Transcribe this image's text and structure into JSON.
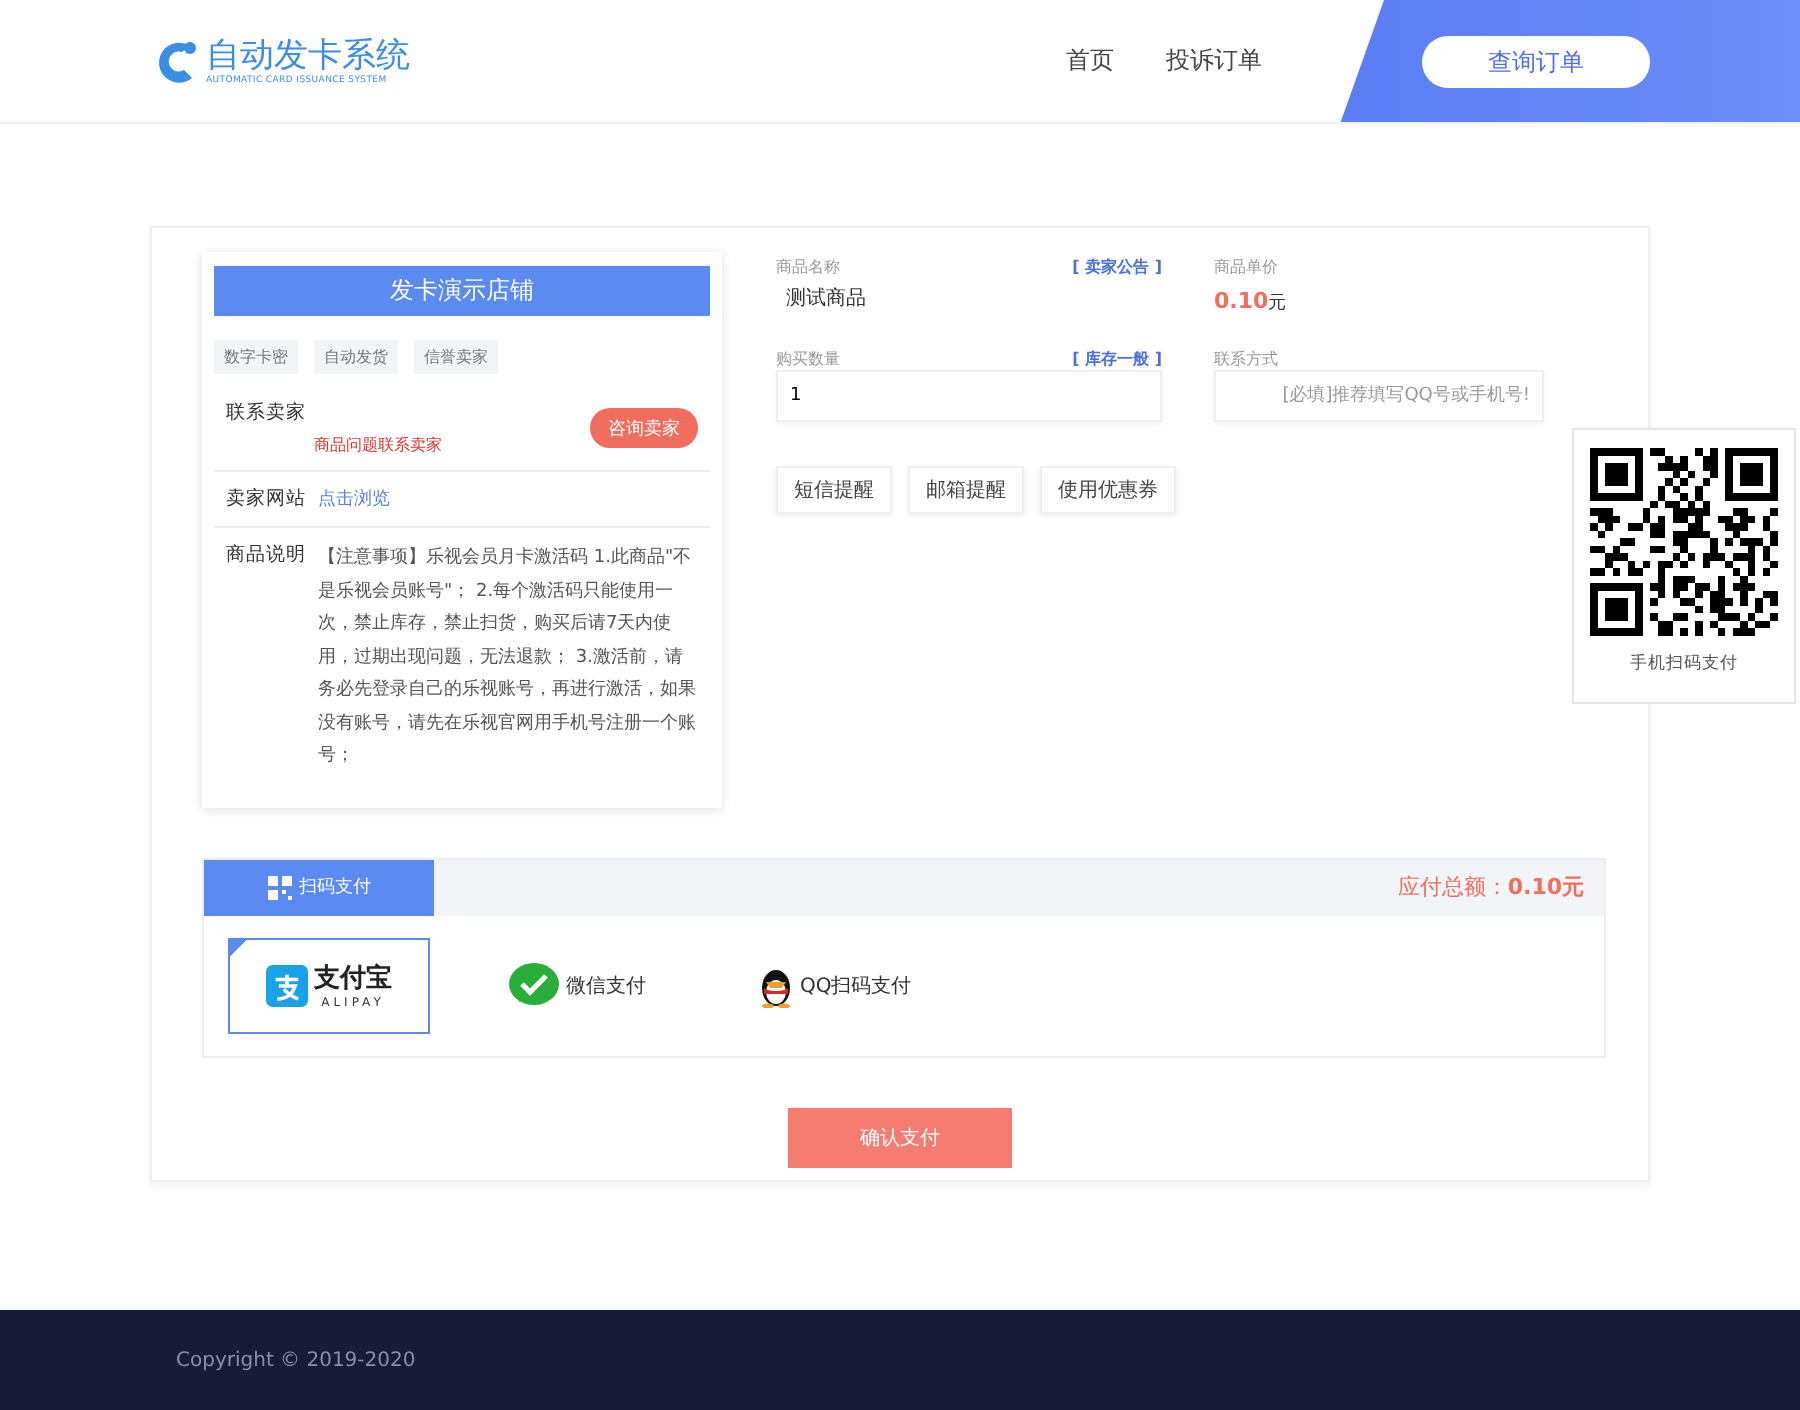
{
  "header": {
    "logo_title": "自动发卡系统",
    "logo_subtitle": "AUTOMATIC CARD ISSUANCE SYSTEM",
    "nav": [
      {
        "label": "首页"
      },
      {
        "label": "投诉订单"
      }
    ],
    "query_button": "查询订单"
  },
  "store": {
    "name": "发卡演示店铺",
    "tags": [
      "数字卡密",
      "自动发货",
      "信誉卖家"
    ],
    "contact_label": "联系卖家",
    "contact_hint": "商品问题联系卖家",
    "contact_button": "咨询卖家",
    "site_label": "卖家网站",
    "site_link": "点击浏览",
    "desc_label": "商品说明",
    "description": "【注意事项】乐视会员月卡激活码 1.此商品\"不是乐视会员账号\"； 2.每个激活码只能使用一次，禁止库存，禁止扫货，购买后请7天内使用，过期出现问题，无法退款； 3.激活前，请务必先登录自己的乐视账号，再进行激活，如果没有账号，请先在乐视官网用手机号注册一个账号；"
  },
  "product": {
    "name_label": "商品名称",
    "name": "测试商品",
    "notice_link": "[ 卖家公告 ]",
    "price_label": "商品单价",
    "price": "0.10",
    "price_unit": "元",
    "quantity_label": "购买数量",
    "stock_link": "[ 库存一般 ]",
    "quantity": "1",
    "contact_field_label": "联系方式",
    "contact_placeholder": "[必填]推荐填写QQ号或手机号!",
    "buttons": [
      "短信提醒",
      "邮箱提醒",
      "使用优惠券"
    ]
  },
  "qr_popup": {
    "caption": "手机扫码支付"
  },
  "payment": {
    "tabs": [
      {
        "label": "扫码支付",
        "selected": true
      }
    ],
    "total_label": "应付总额：",
    "total": "0.10元",
    "methods": [
      {
        "kind": "alipay",
        "label": "支付宝",
        "sublabel": "ALIPAY",
        "selected": true
      },
      {
        "kind": "wechat",
        "label": "微信支付",
        "selected": false
      },
      {
        "kind": "qq",
        "label": "QQ扫码支付",
        "selected": false
      }
    ],
    "confirm_button": "确认支付"
  },
  "footer": {
    "copyright": "Copyright © 2019-2020"
  }
}
